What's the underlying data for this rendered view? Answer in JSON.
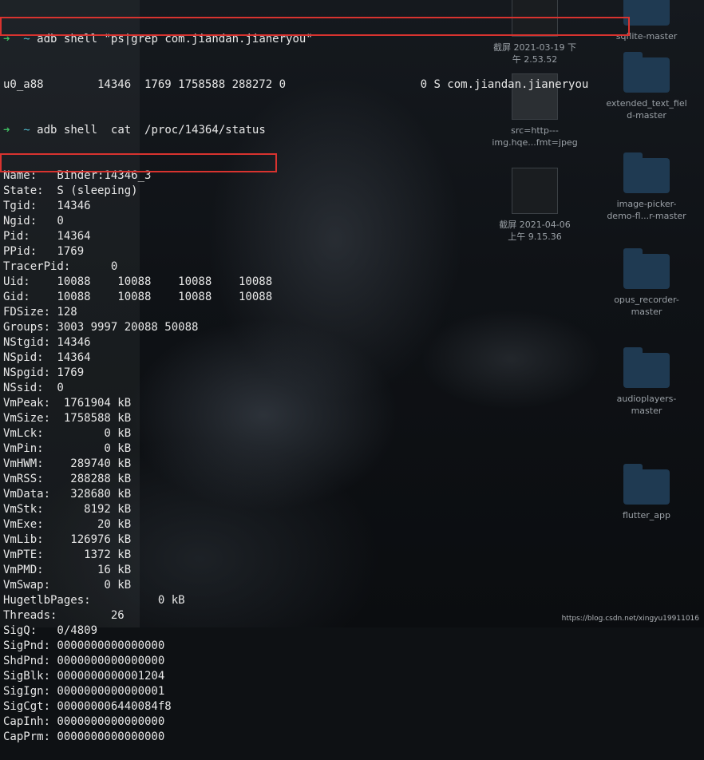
{
  "desktop": {
    "items": [
      {
        "label": "截屏 2021-03-19 下\n午 2.53.52",
        "kind": "screenshot"
      },
      {
        "label": "sqflite-master",
        "kind": "folder"
      },
      {
        "label": "src=http---\nimg.hqe...fmt=jpeg",
        "kind": "image"
      },
      {
        "label": "extended_text_fiel\nd-master",
        "kind": "folder"
      },
      {
        "label": "截屏 2021-04-06\n上午 9.15.36",
        "kind": "screenshot"
      },
      {
        "label": "image-picker-\ndemo-fl...r-master",
        "kind": "folder"
      },
      {
        "label": "opus_recorder-\nmaster",
        "kind": "folder"
      },
      {
        "label": "audioplayers-\nmaster",
        "kind": "folder"
      },
      {
        "label": "flutter_app",
        "kind": "folder"
      }
    ],
    "watermark": "https://blog.csdn.net/xingyu19911016"
  },
  "terminal": {
    "prompt_arrow": "➜",
    "prompt_dir": "~",
    "commands": [
      "adb shell \"ps|grep com.jiandan.jianeryou\"",
      "adb shell  cat  /proc/14364/status"
    ],
    "ps_output": "u0_a88        14346  1769 1758588 288272 0                    0 S com.jiandan.jianeryou",
    "status_lines": [
      "Name:   Binder:14346_3",
      "State:  S (sleeping)",
      "Tgid:   14346",
      "Ngid:   0",
      "Pid:    14364",
      "PPid:   1769",
      "TracerPid:      0",
      "Uid:    10088    10088    10088    10088",
      "Gid:    10088    10088    10088    10088",
      "FDSize: 128",
      "Groups: 3003 9997 20088 50088",
      "NStgid: 14346",
      "NSpid:  14364",
      "NSpgid: 1769",
      "NSsid:  0",
      "VmPeak:  1761904 kB",
      "VmSize:  1758588 kB",
      "VmLck:         0 kB",
      "VmPin:         0 kB",
      "VmHWM:    289740 kB",
      "VmRSS:    288288 kB",
      "VmData:   328680 kB",
      "VmStk:      8192 kB",
      "VmExe:        20 kB",
      "VmLib:    126976 kB",
      "VmPTE:      1372 kB",
      "VmPMD:        16 kB",
      "VmSwap:        0 kB",
      "HugetlbPages:          0 kB",
      "Threads:        26",
      "SigQ:   0/4809",
      "SigPnd: 0000000000000000",
      "ShdPnd: 0000000000000000",
      "SigBlk: 0000000000001204",
      "SigIgn: 0000000000000001",
      "SigCgt: 000000006440084f8",
      "CapInh: 0000000000000000",
      "CapPrm: 0000000000000000"
    ]
  },
  "colors": {
    "highlight": "#d8332f",
    "prompt_arrow": "#3fbf62",
    "prompt_dir": "#4fb8c9",
    "text": "#e8e8e8"
  }
}
